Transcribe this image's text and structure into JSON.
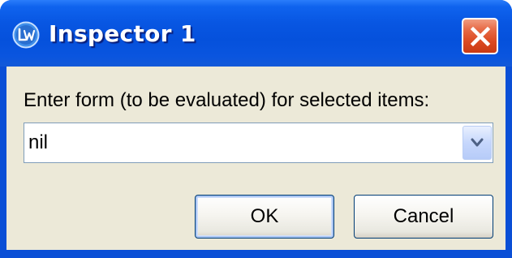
{
  "window": {
    "title": "Inspector 1",
    "app_icon": "lispworks-logo-icon",
    "close_icon": "close-icon"
  },
  "dialog": {
    "prompt": "Enter form (to be evaluated) for selected items:",
    "form_input": {
      "value": "nil",
      "dropdown_icon": "chevron-down-icon"
    },
    "ok_label": "OK",
    "cancel_label": "Cancel"
  },
  "colors": {
    "titlebar": "#0551dc",
    "close_button": "#dc4a22",
    "client_background": "#ece9d8",
    "button_border": "#003c74"
  }
}
